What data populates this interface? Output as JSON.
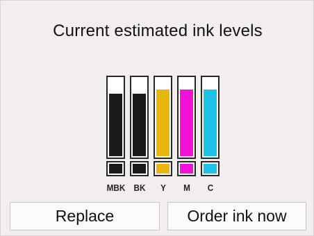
{
  "screen": {
    "title": "Current estimated ink levels"
  },
  "ink": [
    {
      "label": "MBK",
      "level": 0.8,
      "color": "#1a1a1a"
    },
    {
      "label": "BK",
      "level": 0.8,
      "color": "#1a1a1a"
    },
    {
      "label": "Y",
      "level": 0.86,
      "color": "#e8b60c"
    },
    {
      "label": "M",
      "level": 0.86,
      "color": "#f20fd8"
    },
    {
      "label": "C",
      "level": 0.86,
      "color": "#1fc2e6"
    }
  ],
  "buttons": {
    "replace_label": "Replace",
    "order_label": "Order ink now"
  }
}
